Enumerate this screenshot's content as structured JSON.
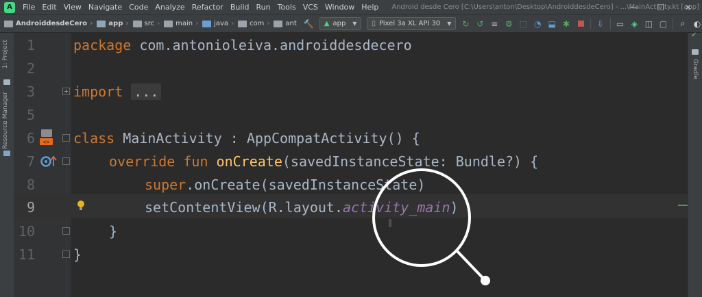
{
  "menubar": {
    "items": [
      "File",
      "Edit",
      "View",
      "Navigate",
      "Code",
      "Analyze",
      "Refactor",
      "Build",
      "Run",
      "Tools",
      "VCS",
      "Window",
      "Help"
    ],
    "window_title": "Android desde Cero [C:\\Users\\anton\\Desktop\\AndroiddesdeCero] - ...\\MainActivity.kt [app]",
    "controls": [
      "—",
      "☐",
      "✕"
    ]
  },
  "navbar": {
    "breadcrumbs": [
      "AndroiddesdeCero",
      "app",
      "src",
      "main",
      "java",
      "com",
      "ant"
    ],
    "run_config": "app",
    "device": "Pixel 3a XL API 30"
  },
  "left_strip": {
    "project_label": "1: Project",
    "resource_manager_label": "Resource Manager"
  },
  "right_strip": {
    "gradle_label": "Gradle"
  },
  "editor": {
    "line_numbers": [
      "1",
      "2",
      "3",
      "5",
      "6",
      "7",
      "8",
      "9",
      "10",
      "11"
    ],
    "current_line": "9",
    "code": {
      "line1_kw": "package",
      "line1_rest": " com.antonioleiva.androiddesdecero",
      "line3_kw": "import",
      "line3_fold": "...",
      "line6_kw": "class",
      "line6_rest": " MainActivity : AppCompatActivity() {",
      "line7_kw": "override fun",
      "line7_fn": "onCreate",
      "line7_rest": "(savedInstanceState: Bundle?) {",
      "line8_kw": "super",
      "line8_rest": ".onCreate(savedInstanceState)",
      "line9_pre": "setContentView(R.layout.",
      "line9_prop": "activity_main",
      "line9_post": ")",
      "line10": "}",
      "line11": "}"
    }
  },
  "colors": {
    "keyword": "#cc7832",
    "function": "#ffc66d",
    "property": "#9876aa",
    "text": "#a9b7c6",
    "background": "#2b2b2b"
  },
  "icons": {
    "gutter_line6": "class-hierarchy-icon",
    "gutter_line7": "override-method-icon",
    "gutter_line9": "lightbulb-icon",
    "overlay": "magnifier-icon"
  }
}
